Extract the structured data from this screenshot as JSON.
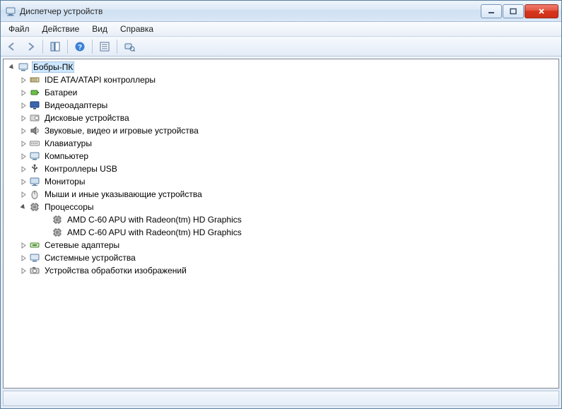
{
  "window": {
    "title": "Диспетчер устройств"
  },
  "menu": {
    "file": "Файл",
    "action": "Действие",
    "view": "Вид",
    "help": "Справка"
  },
  "tree": {
    "root": "Бобры-ПК",
    "cat": {
      "ide": "IDE ATA/ATAPI контроллеры",
      "batteries": "Батареи",
      "display": "Видеоадаптеры",
      "disks": "Дисковые устройства",
      "sound": "Звуковые, видео и игровые устройства",
      "keyboards": "Клавиатуры",
      "computer": "Компьютер",
      "usb": "Контроллеры USB",
      "monitors": "Мониторы",
      "mice": "Мыши и иные указывающие устройства",
      "processors": "Процессоры",
      "network": "Сетевые адаптеры",
      "system": "Системные устройства",
      "imaging": "Устройства обработки изображений"
    },
    "cpu": {
      "item0": "AMD C-60 APU with Radeon(tm) HD Graphics",
      "item1": "AMD C-60 APU with Radeon(tm) HD Graphics"
    }
  }
}
